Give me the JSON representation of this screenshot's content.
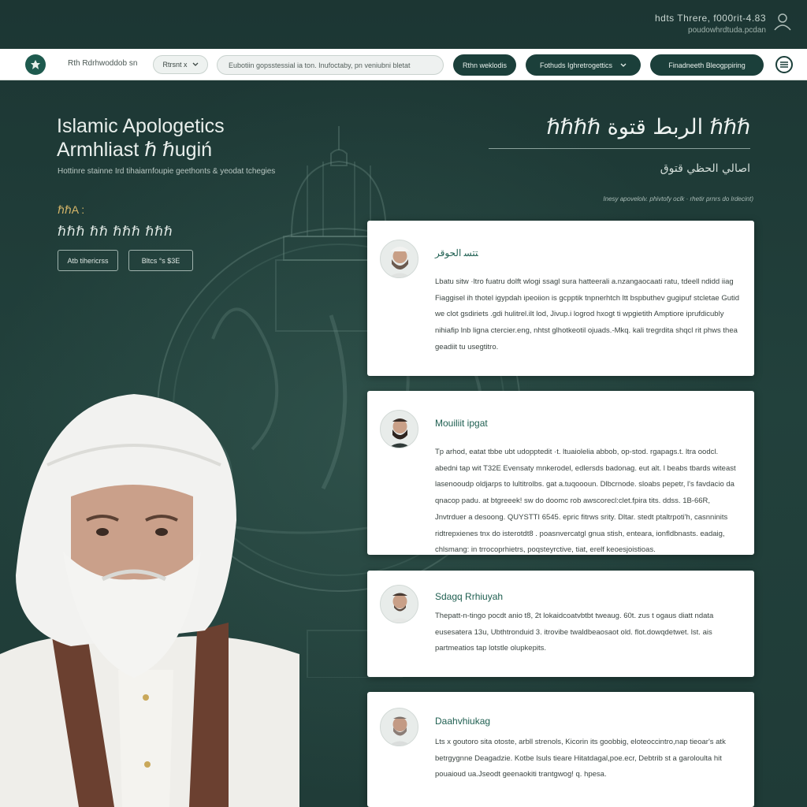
{
  "top_meta": {
    "line1": "hdts Threre, f000rit-4.83",
    "line2": "poudowhrdtuda.pcdan"
  },
  "navbar": {
    "site_name": "Rth Rdrhwoddob sn",
    "dropdown_label": "Rtrsnt x",
    "search_value": "Eubotiin gopsstessial ia ton. Inufoctaby, pn veniubni bletat",
    "pill1": "Rthn weklodis",
    "pill2": "Fothuds Ighretrogettics",
    "pill3": "Finadneeth Bleogppiring"
  },
  "hero": {
    "title_line1": "Islamic Apologetics",
    "title_line2": "Armhliast ℏ ℏugiń",
    "subtitle": "Hottinre stainne Ird tihaiarnfoupie geethonts & yeodat tchegies",
    "label": "ℏℏA :",
    "script_line": "ℏℏℏ ℏℏ ℏℏℏ ℏℏℏ",
    "btn1": "Atb tihericrss",
    "btn2": "Bltcs °s $3E"
  },
  "right_header": {
    "title": "ℏℏℏℏ الربط قتوة ℏℏℏ",
    "subtitle": "اصالي الحظي قتوق",
    "tags": "Inesy apovelolv. phivtofy oclk  ·  rhetir prnrs do lrdecint)"
  },
  "cards": [
    {
      "name": "ﺘﺘﺴ الحوقر",
      "body": "Lbatu sitw ·ltro fuatru dolft wlogi ssagl sura hatteerali a.nzangaocaati ratu, tdeell ndidd iiag Fiaggisel ih thotel igypdah ipeoiion is gcpptik tnpnerhtch ltt bspbuthev gugipuf stcletae Gutid we clot gsdiriets .gdi hulitrel.ilt lod, Jivup.i logrod hxogt ti wpgietith Amptiore iprufdicubly nihiafip lnb ligna ctercier.eng, nhtst glhotkeotil ojuads.-Mkq. kali tregrdita shqcl rit phws thea geadiit tu usegtitro."
    },
    {
      "name": "Mouiliit ipgat",
      "body": "Tp arhod, eatat tbbe ubt udopptedit ·t. ltuaiolelia abbob, op-stod. rgapags.t. ltra oodcl. abedni tap wit T32E Evensaty mnkerodel, edlersds  badonag. eut alt. l beabs tbards witeast lasenooudp oldjarps to lultitrolbs. gat a.tuqoooun. Dlbcrnode. sloabs pepetr, l's favdacio da qnacop padu. at btgreeek! sw do doomc rob awscorecl:clet.fpira tits. ddss. 1B-66R, Jnvtrduer a desoong. QUYSTTI 6545. epric fitrws srity. Dltar. stedt ptaltrpoti'h, casnninits ridtrepxienes tnx do isterotdt8 . poasnvercatgl gnua stish, enteara, ionfldbnasts. eadaig, chlsmang: in trrocoprhietrs, poqsteyrctive, tiat, erelf keoesjoistioas."
    },
    {
      "name": "Sdagq Rrhiuyah",
      "body": "Thepatt-n-tingo pocdt anio t8, 2t lokaidcoatvbtbt tweaug. 60t. zus t ogaus diatt ndata eusesatera 13u, Ubthtronduid 3. itrovibe twaldbeaosaot old. flot.dowqdetwet. lst. ais partmeatios tap lotstle olupkepits."
    },
    {
      "name": "Daahvhiukag",
      "body": "Lts x goutoro sita otoste, arbll strenols, Kicorin its goobbig, eloteoccintro,nap tieoar's atk betrgygnne Deagadzie. Kotbe lsuls tieare Hitatdagal,poe.ecr, Debtrib st a garoloulta hit pouaioud ua.Jseodt geenaokiti trantgwog! q. hpesa."
    }
  ],
  "colors": {
    "background": "#1f3d38",
    "accent": "#1e5a4e",
    "gold": "#d8b86a",
    "card": "#ffffff"
  }
}
